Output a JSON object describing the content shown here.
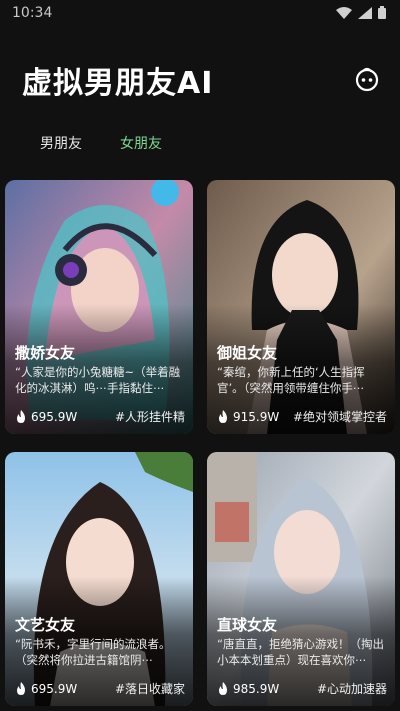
{
  "status_bar": {
    "time": "10:34",
    "icons": [
      "wifi-icon",
      "signal-icon",
      "battery-icon"
    ]
  },
  "header": {
    "title": "虚拟男朋友AI",
    "profile_icon": "mascot-face-icon"
  },
  "tabs": [
    {
      "label": "男朋友",
      "active": false
    },
    {
      "label": "女朋友",
      "active": true
    }
  ],
  "colors": {
    "background": "#111111",
    "active_tab": "#7bd88f",
    "text": "#ffffff"
  },
  "cards": [
    {
      "name": "撒娇女友",
      "quote": "“人家是你的小兔糖糖~（举着融化的冰淇淋）呜⋯手指黏住⋯",
      "count": "695.9W",
      "tag": "#人形挂件精",
      "icon": "flame-icon"
    },
    {
      "name": "御姐女友",
      "quote": "“秦绾，你新上任的‘人生指挥官’。（突然用领带缠住你手⋯",
      "count": "915.9W",
      "tag": "#绝对领域掌控者",
      "icon": "flame-icon"
    },
    {
      "name": "文艺女友",
      "quote": "“阮书禾，字里行间的流浪者。（突然将你拉进古籍馆阴⋯",
      "count": "695.9W",
      "tag": "#落日收藏家",
      "icon": "flame-icon"
    },
    {
      "name": "直球女友",
      "quote": "“唐直直，拒绝猜心游戏！（掏出小本本划重点）现在喜欢你⋯",
      "count": "985.9W",
      "tag": "#心动加速器",
      "icon": "flame-icon"
    }
  ]
}
